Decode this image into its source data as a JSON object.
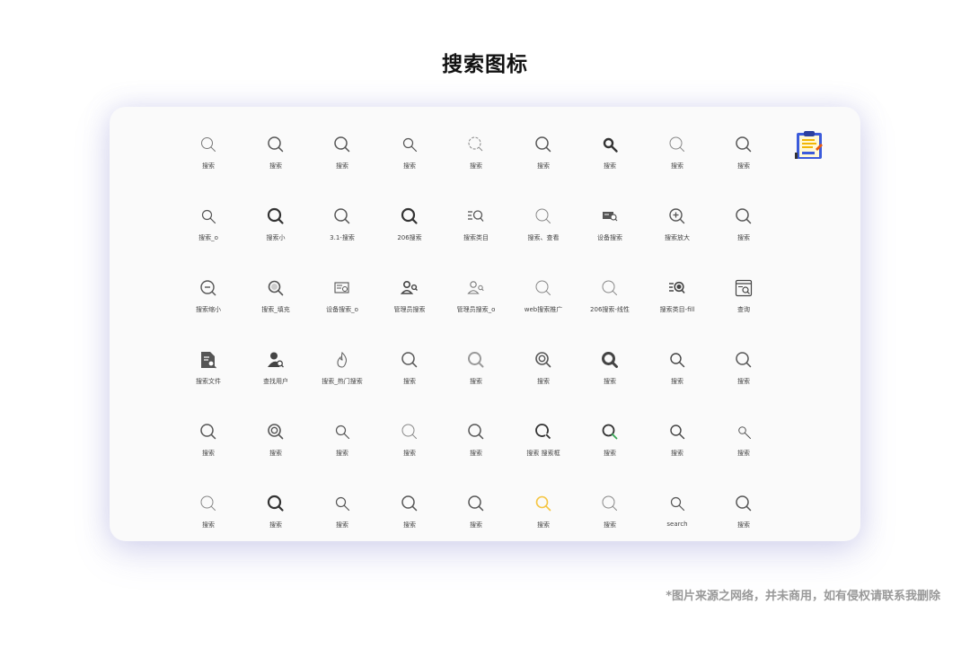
{
  "title": "搜索图标",
  "footnote": "*图片来源之网络，并未商用，如有侵权请联系我删除",
  "rows": [
    [
      {
        "label": "搜索",
        "icon": "search-icon-thin-key"
      },
      {
        "label": "搜索",
        "icon": "search-icon"
      },
      {
        "label": "搜索",
        "icon": "search-icon"
      },
      {
        "label": "搜索",
        "icon": "search-icon-small"
      },
      {
        "label": "搜索",
        "icon": "search-icon-dashed"
      },
      {
        "label": "搜索",
        "icon": "search-icon"
      },
      {
        "label": "搜索",
        "icon": "search-icon-bold-small"
      },
      {
        "label": "搜索",
        "icon": "search-icon-light"
      },
      {
        "label": "搜索",
        "icon": "search-icon"
      }
    ],
    [
      {
        "label": "搜索_o",
        "icon": "search-icon-small"
      },
      {
        "label": "搜索小",
        "icon": "search-icon-bold"
      },
      {
        "label": "3.1-搜索",
        "icon": "search-icon"
      },
      {
        "label": "206搜索",
        "icon": "search-icon-bold"
      },
      {
        "label": "搜索类目",
        "icon": "search-list-icon"
      },
      {
        "label": "搜索、查看",
        "icon": "search-icon-light"
      },
      {
        "label": "设备搜索",
        "icon": "device-search-icon"
      },
      {
        "label": "搜索放大",
        "icon": "zoom-in-icon"
      },
      {
        "label": "搜索",
        "icon": "search-icon"
      }
    ],
    [
      {
        "label": "搜索缩小",
        "icon": "zoom-out-icon"
      },
      {
        "label": "搜索_填充",
        "icon": "search-filled-icon"
      },
      {
        "label": "设备搜索_o",
        "icon": "device-search-outline-icon"
      },
      {
        "label": "管理员搜索",
        "icon": "user-search-icon"
      },
      {
        "label": "管理员搜索_o",
        "icon": "user-search-outline-icon"
      },
      {
        "label": "web搜索推广",
        "icon": "search-icon-light"
      },
      {
        "label": "206搜索-线性",
        "icon": "search-icon-light"
      },
      {
        "label": "搜索类目-fill",
        "icon": "search-list-filled-icon"
      },
      {
        "label": "查询",
        "icon": "query-window-icon"
      }
    ],
    [
      {
        "label": "搜索文件",
        "icon": "file-search-icon"
      },
      {
        "label": "查找用户",
        "icon": "find-user-icon"
      },
      {
        "label": "搜索_热门搜索",
        "icon": "flame-icon"
      },
      {
        "label": "搜索",
        "icon": "search-icon"
      },
      {
        "label": "搜索",
        "icon": "search-icon-gray"
      },
      {
        "label": "搜索",
        "icon": "search-icon-double-ring"
      },
      {
        "label": "搜索",
        "icon": "search-icon-heavy"
      },
      {
        "label": "搜索",
        "icon": "search-icon-long-handle"
      },
      {
        "label": "搜索",
        "icon": "search-icon"
      }
    ],
    [
      {
        "label": "搜索",
        "icon": "search-icon"
      },
      {
        "label": "搜索",
        "icon": "search-icon-double-ring"
      },
      {
        "label": "搜索",
        "icon": "search-icon-small"
      },
      {
        "label": "搜索",
        "icon": "search-icon-light"
      },
      {
        "label": "搜索",
        "icon": "search-icon"
      },
      {
        "label": "搜索 搜索框",
        "icon": "search-icon-open"
      },
      {
        "label": "搜索",
        "icon": "search-icon-green-handle"
      },
      {
        "label": "搜索",
        "icon": "search-icon-long-handle"
      },
      {
        "label": "搜索",
        "icon": "search-icon-tiny"
      }
    ],
    [
      {
        "label": "搜索",
        "icon": "search-icon-light"
      },
      {
        "label": "搜索",
        "icon": "search-icon-bold"
      },
      {
        "label": "搜索",
        "icon": "search-icon-small"
      },
      {
        "label": "搜索",
        "icon": "search-icon"
      },
      {
        "label": "搜索",
        "icon": "search-icon"
      },
      {
        "label": "搜索",
        "icon": "search-icon-yellow"
      },
      {
        "label": "搜索",
        "icon": "search-icon-light"
      },
      {
        "label": "search",
        "icon": "search-icon-small"
      },
      {
        "label": "搜索",
        "icon": "search-icon"
      }
    ]
  ],
  "badge_icon": "clipboard-document-icon",
  "colors": {
    "accent_yellow": "#f5c542",
    "accent_green": "#3aa757",
    "icon_gray": "#555555",
    "badge_blue": "#3b5bdb"
  }
}
